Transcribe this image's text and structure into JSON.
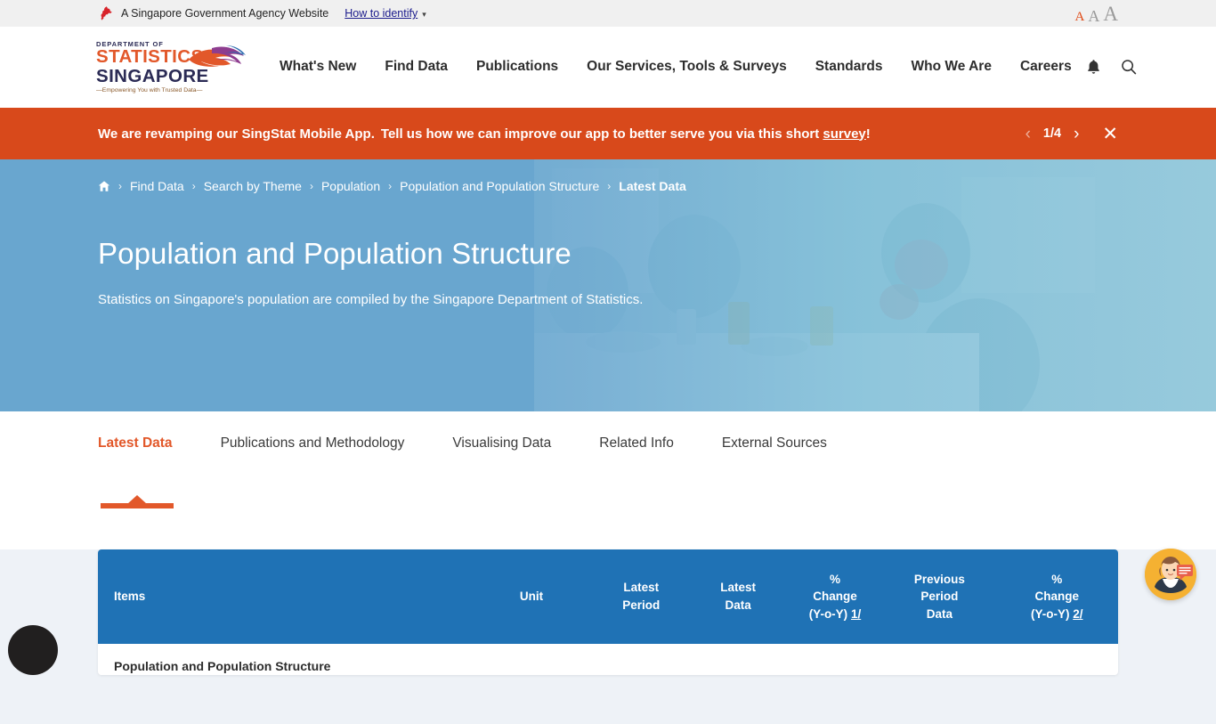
{
  "masthead": {
    "text": "A Singapore Government Agency Website",
    "how_to_identify": "How to identify",
    "lion_icon": "singapore-lion-icon",
    "font_size_options": [
      "A",
      "A",
      "A"
    ],
    "active_font_size": "A"
  },
  "logo": {
    "department": "DEPARTMENT OF",
    "statistics": "STATISTICS",
    "singapore": "SINGAPORE",
    "tagline": "Empowering You with Trusted Data"
  },
  "nav": {
    "items": [
      {
        "label": "What's New"
      },
      {
        "label": "Find Data"
      },
      {
        "label": "Publications"
      },
      {
        "label": "Our Services, Tools & Surveys"
      },
      {
        "label": "Standards"
      },
      {
        "label": "Who We Are"
      },
      {
        "label": "Careers"
      }
    ],
    "icons": [
      {
        "name": "bell-icon"
      },
      {
        "name": "search-icon"
      }
    ]
  },
  "banner": {
    "text_part1": "We are revamping our SingStat Mobile App.",
    "text_part2": "Tell us how we can improve our app to better serve you via this short",
    "link_label": "survey",
    "text_end": "!",
    "counter": "1/4",
    "prev_label": "‹",
    "next_label": "›",
    "close_label": "✕",
    "background_color": "#d8491b"
  },
  "hero": {
    "breadcrumb": [
      {
        "label": "home-icon",
        "type": "icon"
      },
      {
        "label": "Find Data",
        "type": "link"
      },
      {
        "label": "Search by Theme",
        "type": "link"
      },
      {
        "label": "Population",
        "type": "link"
      },
      {
        "label": "Population and Population Structure",
        "type": "link"
      },
      {
        "label": "Latest Data",
        "type": "current"
      }
    ],
    "separator": "›",
    "title": "Population and Population Structure",
    "subtitle": "Statistics on Singapore's population are compiled by the Singapore Department of Statistics.",
    "background_color": "#69a6cf"
  },
  "tabs": {
    "items": [
      {
        "label": "Latest Data",
        "active": true
      },
      {
        "label": "Publications and Methodology",
        "active": false
      },
      {
        "label": "Visualising Data",
        "active": false
      },
      {
        "label": "Related Info",
        "active": false
      },
      {
        "label": "External Sources",
        "active": false
      }
    ],
    "accent_color": "#e2582a"
  },
  "table": {
    "header_color": "#1f72b5",
    "columns": [
      {
        "key": "items",
        "label": "Items"
      },
      {
        "key": "unit",
        "label": "Unit"
      },
      {
        "key": "latest_period",
        "line1": "Latest",
        "line2": "Period"
      },
      {
        "key": "latest_data",
        "line1": "Latest",
        "line2": "Data"
      },
      {
        "key": "pct_change_1",
        "line1": "%",
        "line2": "Change",
        "line3": "(Y-o-Y)",
        "footnote": "1/"
      },
      {
        "key": "previous_period_data",
        "line1": "Previous",
        "line2": "Period",
        "line3": "Data"
      },
      {
        "key": "pct_change_2",
        "line1": "%",
        "line2": "Change",
        "line3": "(Y-o-Y)",
        "footnote": "2/"
      }
    ],
    "rows": [
      {
        "items": "Population and Population Structure",
        "unit": "",
        "latest_period": "",
        "latest_data": "",
        "pct_change_1": "",
        "previous_period_data": "",
        "pct_change_2": ""
      }
    ]
  },
  "widgets": {
    "chatbot_icon": "chatbot-avatar-icon",
    "accessibility_icon": "accessibility-icon"
  }
}
